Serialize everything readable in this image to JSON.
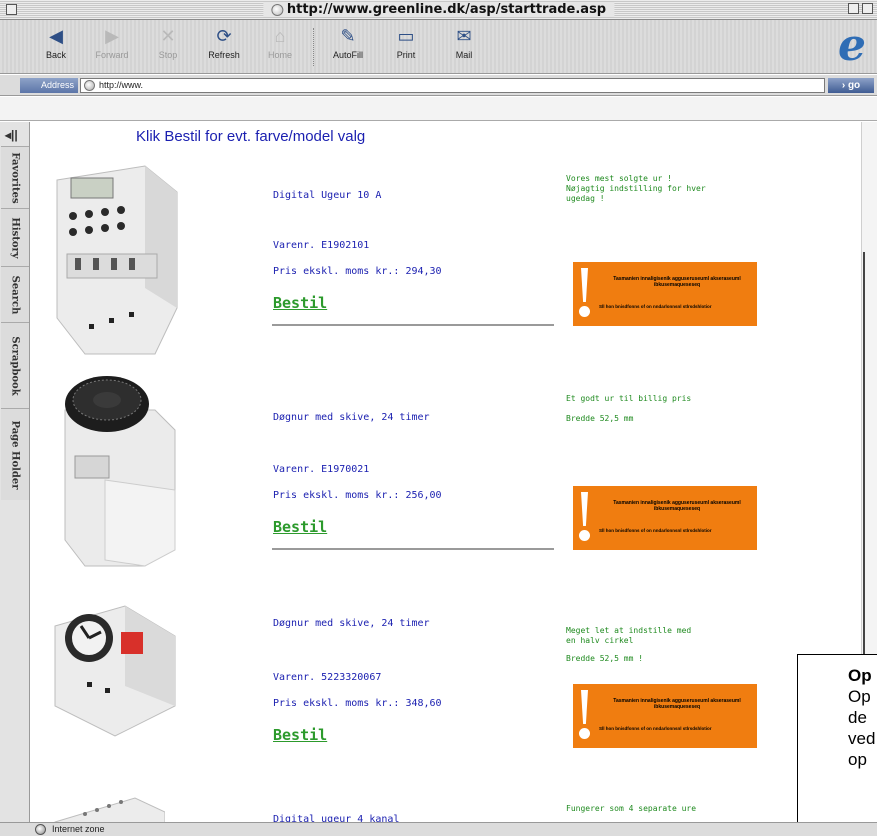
{
  "window": {
    "title": "http://www.greenline.dk/asp/starttrade.asp"
  },
  "toolbar": {
    "back": "Back",
    "forward": "Forward",
    "stop": "Stop",
    "refresh": "Refresh",
    "home": "Home",
    "autofill": "AutoFill",
    "print": "Print",
    "mail": "Mail"
  },
  "address": {
    "label": "Address",
    "value": "http://www.",
    "go": "go"
  },
  "explorer_tabs": [
    "Favorites",
    "History",
    "Search",
    "Scrapbook",
    "Page Holder"
  ],
  "page": {
    "heading": "Klik Bestil for evt. farve/model valg",
    "products": [
      {
        "name": "Digital Ugeur 10 A",
        "varenr": "Varenr. E1902101",
        "pris": "Pris ekskl. moms kr.: 294,30",
        "bestil": "Bestil",
        "desc_lines": [
          "Vores mest solgte ur !",
          "Nøjagtig indstilling for hver",
          "ugedag !"
        ]
      },
      {
        "name": "Døgnur med skive, 24 timer",
        "varenr": "Varenr. E1970021",
        "pris": "Pris ekskl. moms kr.: 256,00",
        "bestil": "Bestil",
        "desc_lines": [
          "Et godt ur til billig pris",
          "",
          "Bredde 52,5 mm"
        ]
      },
      {
        "name": "Døgnur med skive, 24 timer",
        "varenr": "Varenr. 5223320067",
        "pris": "Pris ekskl. moms kr.: 348,60",
        "bestil": "Bestil",
        "desc_lines": [
          "Meget let at indstille med",
          "en halv cirkel",
          "",
          "Bredde 52,5 mm !"
        ]
      },
      {
        "name": "Digital ugeur 4 kanal",
        "desc_lines": [
          "Fungerer som 4 separate ure"
        ]
      }
    ],
    "warning_badge": {
      "line1": "Tasmanien innaligisenik agguseruseuml akseraseuml ibkusemaqueseseq",
      "line2": "Sll hon bnisdfonns of on nndarlonnsnl stlrsdshlotior"
    }
  },
  "callout": {
    "title": "Op",
    "lines": [
      "Op",
      "de",
      "ved",
      "op"
    ]
  },
  "statusbar": {
    "zone": "Internet zone"
  },
  "colors": {
    "link_blue": "#1a1fb0",
    "bestil_green": "#2c9a2c",
    "desc_green": "#1f8a1f",
    "warning_orange": "#f07d10"
  }
}
